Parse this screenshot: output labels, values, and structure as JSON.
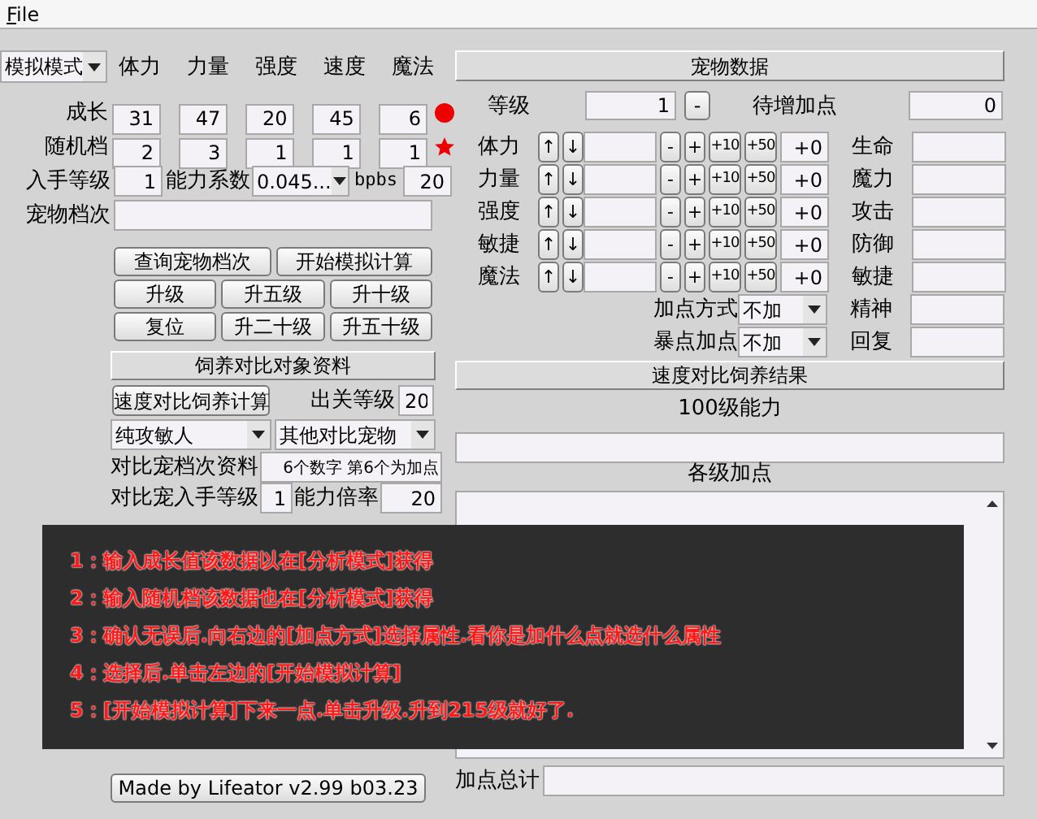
{
  "menu": [
    "File"
  ],
  "mode_dropdown": "模拟模式",
  "stat_headers": [
    "体力",
    "力量",
    "强度",
    "速度",
    "魔法"
  ],
  "stat_rows": [
    {
      "label": "成长",
      "values": [
        "31",
        "47",
        "20",
        "45",
        "6"
      ],
      "kind": "dot"
    },
    {
      "label": "随机档",
      "values": [
        "2",
        "3",
        "1",
        "1",
        "1"
      ],
      "kind": "star"
    }
  ],
  "acquire": {
    "label": "入手等级",
    "value": "1",
    "coef_label": "能力系数",
    "coef": "0.045...",
    "bpbs_label": "bpbs",
    "bpbs": "20"
  },
  "grade": {
    "label": "宠物档次"
  },
  "buttons": [
    [
      "查询宠物档次",
      "开始模拟计算"
    ],
    [
      "升级",
      "升五级",
      "升十级"
    ],
    [
      "复位",
      "升二十级",
      "升五十级"
    ]
  ],
  "compare": {
    "title": "饲养对比对象资料",
    "calc_button": "速度对比饲养计算",
    "exit_level_label": "出关等级",
    "exit_level": "20",
    "dropdowns": [
      "纯攻敏人",
      "其他对比宠物"
    ],
    "grade_label": "对比宠档次资料",
    "grade": "6个数字 第6个为加点",
    "acquire_label": "对比宠入手等级",
    "acquire": "1",
    "ratio_label": "能力倍率",
    "ratio": "20"
  },
  "credit_button": "Made by Lifeator   v2.99 b03.23",
  "pet": {
    "title": "宠物数据",
    "level_label": "等级",
    "level": "1",
    "level_button": "-",
    "pending_label": "待增加点",
    "pending": "0",
    "rows": [
      {
        "label": "体力",
        "buttons": [
          "↑",
          "↓",
          "-",
          "+",
          "+10",
          "+50"
        ],
        "bonus": "+0",
        "right_label": "生命"
      },
      {
        "label": "力量",
        "buttons": [
          "↑",
          "↓",
          "-",
          "+",
          "+10",
          "+50"
        ],
        "bonus": "+0",
        "right_label": "魔力"
      },
      {
        "label": "强度",
        "buttons": [
          "↑",
          "↓",
          "-",
          "+",
          "+10",
          "+50"
        ],
        "bonus": "+0",
        "right_label": "攻击"
      },
      {
        "label": "敏捷",
        "buttons": [
          "↑",
          "↓",
          "-",
          "+",
          "+10",
          "+50"
        ],
        "bonus": "+0",
        "right_label": "防御"
      },
      {
        "label": "魔法",
        "buttons": [
          "↑",
          "↓",
          "-",
          "+",
          "+10",
          "+50"
        ],
        "bonus": "+0",
        "right_label": "敏捷"
      }
    ],
    "mode_rows": [
      {
        "label": "加点方式",
        "value": "不加",
        "right_label": "精神"
      },
      {
        "label": "暴点加点",
        "value": "不加",
        "right_label": "回复"
      }
    ]
  },
  "result": {
    "title": "速度对比饲养结果",
    "ability_label": "100级能力",
    "points_label": "各级加点",
    "total_label": "加点总计"
  },
  "overlay": [
    "1：输入成长值该数据以在**[分析模式]**获得",
    "2：输入随机档该数据也在**[分析模式]**获得",
    "3：确认无误后.向右边的**[加点方式]**选择属性.看你是加什么点就选什么属性",
    "4：选择后.单击左边的**[开始模拟计算]**",
    "5：**[开始模拟计算]**下来一点.单击升级.升到215级就好了."
  ]
}
